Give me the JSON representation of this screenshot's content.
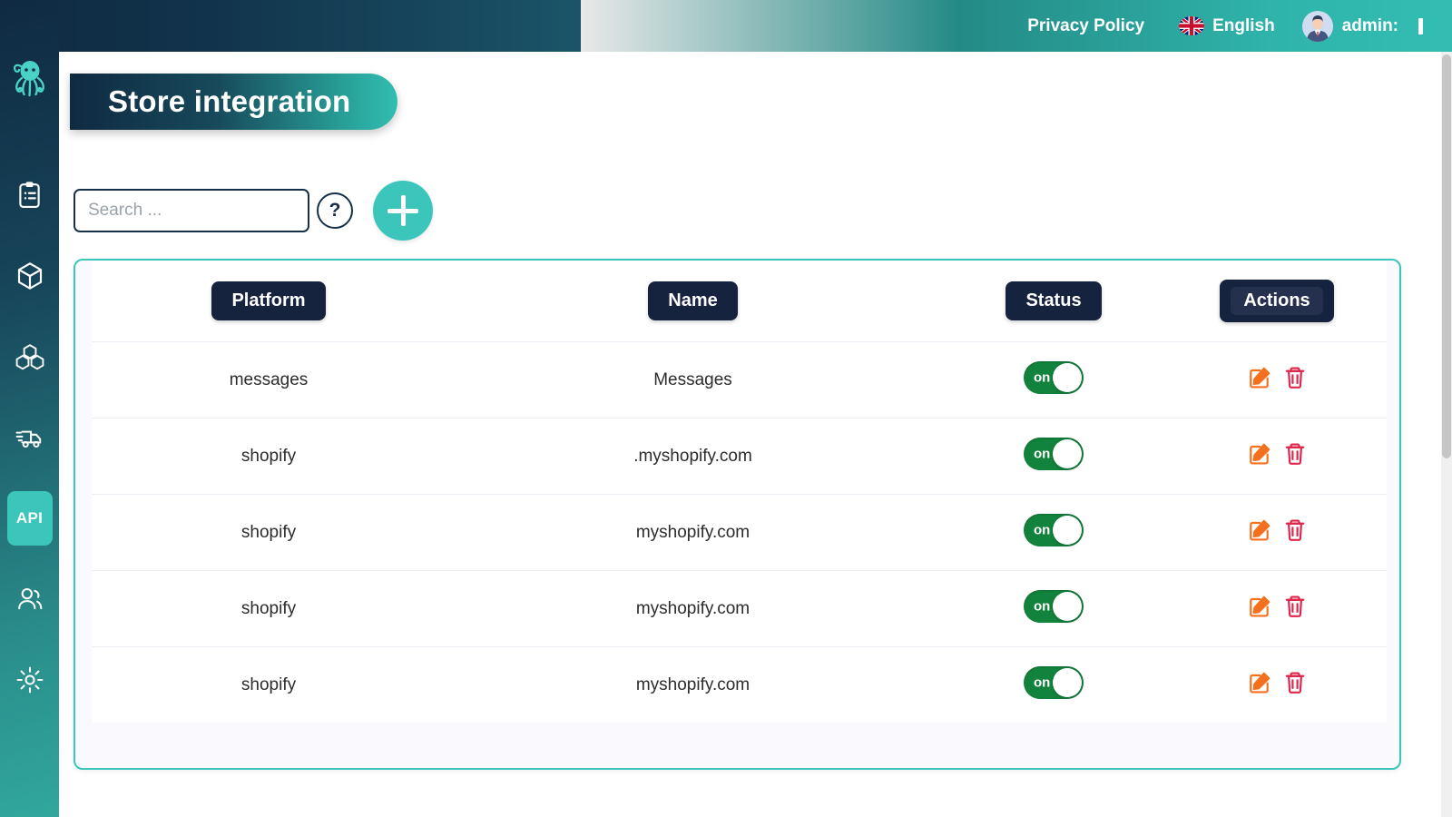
{
  "topbar": {
    "privacy_policy": "Privacy Policy",
    "language": "English",
    "language_icon": "uk-flag-icon",
    "account": "admin:",
    "avatar_icon": "user-avatar-icon"
  },
  "sidebar": {
    "logo_icon": "octopus-logo-icon",
    "items": [
      {
        "icon": "clipboard-list-icon",
        "active": false
      },
      {
        "icon": "cube-icon",
        "active": false
      },
      {
        "icon": "boxes-stacked-icon",
        "active": false
      },
      {
        "icon": "delivery-truck-icon",
        "active": false
      },
      {
        "icon": "api-icon",
        "label": "API",
        "active": true
      },
      {
        "icon": "users-icon",
        "active": false
      },
      {
        "icon": "gear-icon",
        "active": false
      }
    ]
  },
  "page": {
    "title": "Store integration"
  },
  "toolbar": {
    "search_placeholder": "Search ...",
    "search_value": "",
    "help_label": "?",
    "add_label": "+"
  },
  "table": {
    "columns": [
      "Platform",
      "Name",
      "Status",
      "Actions"
    ],
    "rows": [
      {
        "platform": "messages",
        "name": "Messages",
        "status": "on",
        "edit_icon": "edit-pencil-icon",
        "delete_icon": "trash-icon"
      },
      {
        "platform": "shopify",
        "name": ".myshopify.com",
        "status": "on",
        "edit_icon": "edit-pencil-icon",
        "delete_icon": "trash-icon"
      },
      {
        "platform": "shopify",
        "name": "myshopify.com",
        "status": "on",
        "edit_icon": "edit-pencil-icon",
        "delete_icon": "trash-icon"
      },
      {
        "platform": "shopify",
        "name": "myshopify.com",
        "status": "on",
        "edit_icon": "edit-pencil-icon",
        "delete_icon": "trash-icon"
      },
      {
        "platform": "shopify",
        "name": "myshopify.com",
        "status": "on",
        "edit_icon": "edit-pencil-icon",
        "delete_icon": "trash-icon"
      }
    ]
  },
  "colors": {
    "accent_teal": "#3cc6bb",
    "dark_navy": "#16233f",
    "header_gradient_start": "#0f2a42",
    "header_gradient_end": "#33bdb2",
    "toggle_on_green": "#12833c",
    "edit_orange": "#f4701f",
    "delete_red": "#e0254a"
  }
}
